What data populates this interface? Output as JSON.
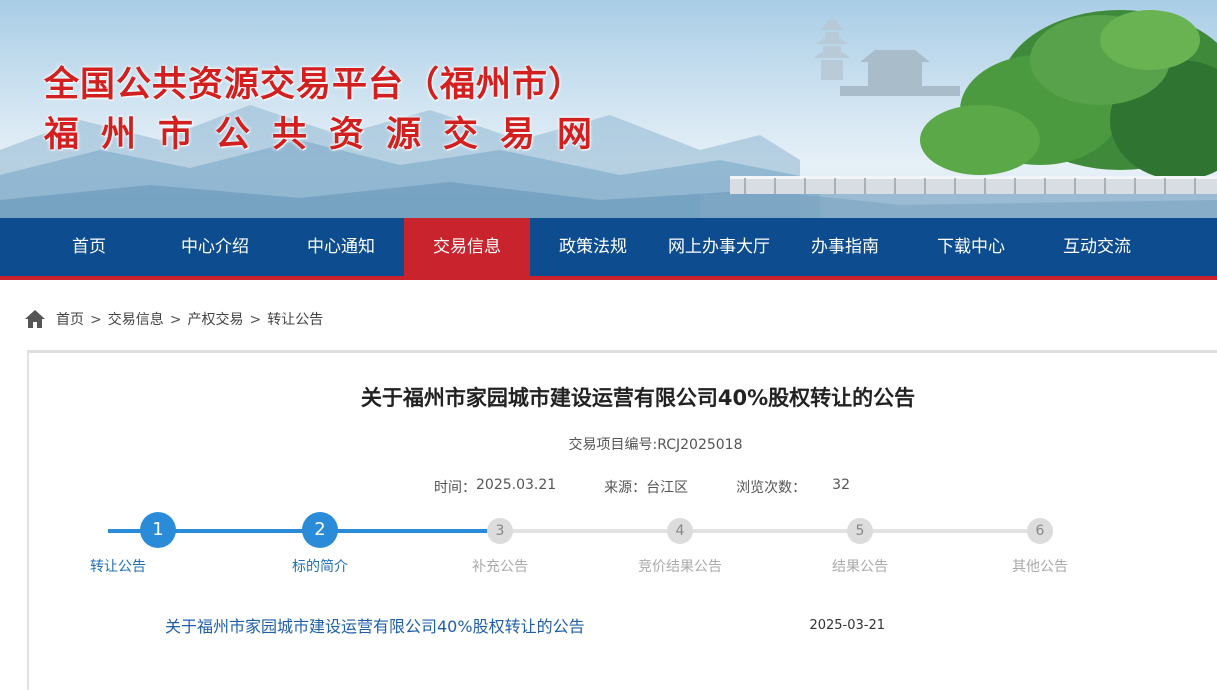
{
  "banner": {
    "title_line1": "全国公共资源交易平台（福州市）",
    "title_line2": "福州市公共资源交易网"
  },
  "nav": {
    "items": [
      {
        "label": "首页"
      },
      {
        "label": "中心介绍"
      },
      {
        "label": "中心通知"
      },
      {
        "label": "交易信息",
        "active": true
      },
      {
        "label": "政策法规"
      },
      {
        "label": "网上办事大厅"
      },
      {
        "label": "办事指南"
      },
      {
        "label": "下载中心"
      },
      {
        "label": "互动交流"
      }
    ]
  },
  "breadcrumb": {
    "items": [
      "首页",
      "交易信息",
      "产权交易",
      "转让公告"
    ],
    "separator": ">"
  },
  "article": {
    "title": "关于福州市家园城市建设运营有限公司40%股权转让的公告",
    "project_code": "交易项目编号:RCJ2025018",
    "time_label": "时间：",
    "time_value": "2025.03.21",
    "source_label": "来源：",
    "source_value": "台江区",
    "views_label": "浏览次数：",
    "views_value": "32"
  },
  "steps": [
    {
      "number": "1",
      "label": "转让公告",
      "state": "done"
    },
    {
      "number": "2",
      "label": "标的简介",
      "state": "done"
    },
    {
      "number": "3",
      "label": "补充公告",
      "state": "todo"
    },
    {
      "number": "4",
      "label": "竞价结果公告",
      "state": "todo"
    },
    {
      "number": "5",
      "label": "结果公告",
      "state": "todo"
    },
    {
      "number": "6",
      "label": "其他公告",
      "state": "todo"
    }
  ],
  "list": [
    {
      "title": "关于福州市家园城市建设运营有限公司40%股权转让的公告",
      "date": "2025-03-21"
    }
  ],
  "colors": {
    "nav_bg": "#0d4d8f",
    "nav_active": "#c9232d",
    "title_red": "#d21f1f",
    "step_active": "#2a8bd9",
    "link_blue": "#1f5fa8"
  },
  "icons": {
    "breadcrumb_home": "home-icon"
  }
}
